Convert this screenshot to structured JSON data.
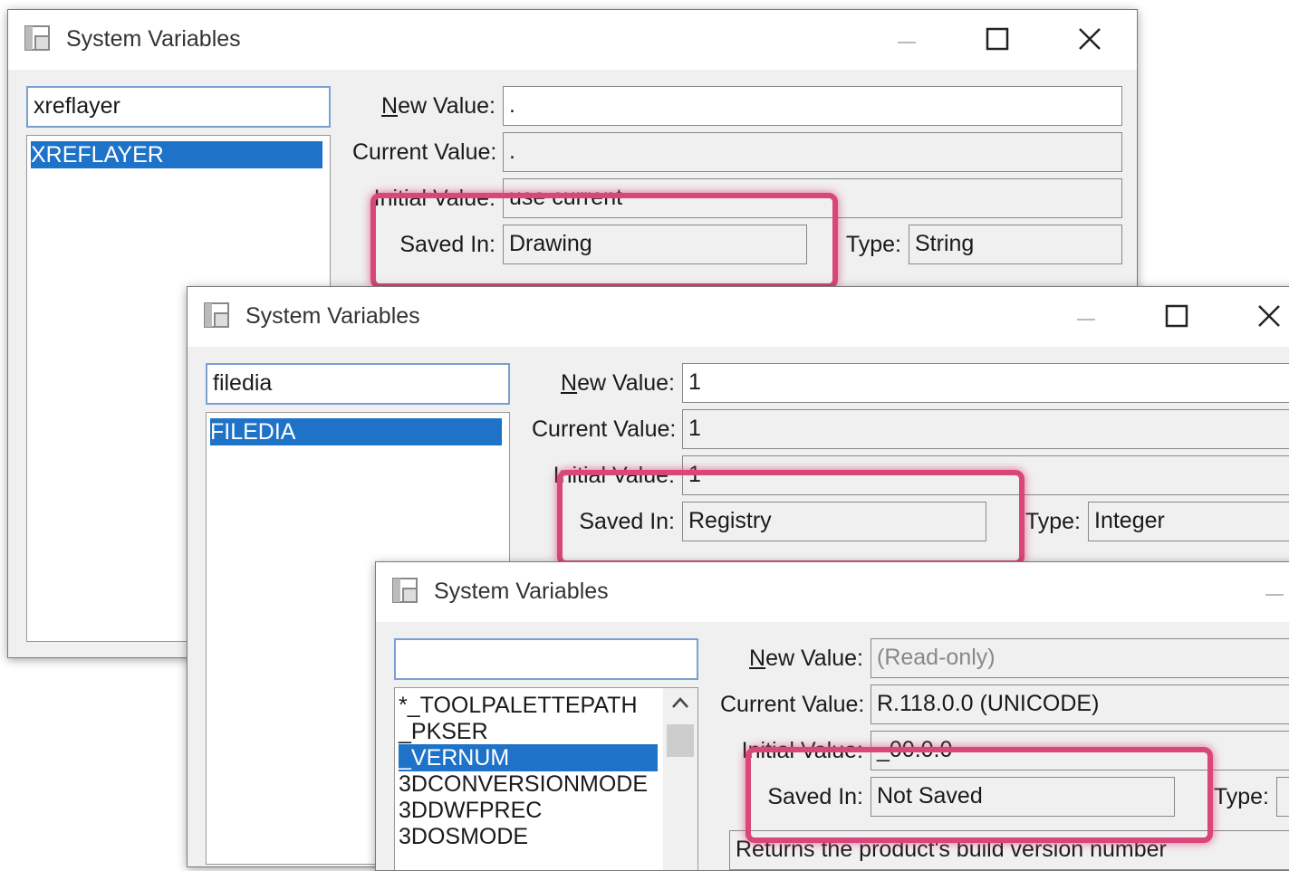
{
  "icons": {
    "app": "system-variables-icon",
    "minimize": "minimize-icon",
    "maximize": "maximize-icon",
    "close": "close-icon",
    "scroll_up": "chevron-up-icon"
  },
  "colors": {
    "selection": "#1e73c8",
    "highlight": "#d8467a"
  },
  "labels": {
    "new_value_prefix": "N",
    "new_value_rest": "ew Value:",
    "current_value": "Current Value:",
    "initial_value": "Initial Value:",
    "saved_in": "Saved In:",
    "type": "Type:"
  },
  "dialog1": {
    "title": "System Variables",
    "search": "xreflayer",
    "list": [
      "XREFLAYER"
    ],
    "new_value": ".",
    "current_value": ".",
    "initial_value": "use current",
    "saved_in": "Drawing",
    "type": "String"
  },
  "dialog2": {
    "title": "System Variables",
    "search": "filedia",
    "list": [
      "FILEDIA"
    ],
    "new_value": "1",
    "current_value": "1",
    "initial_value": "1",
    "saved_in": "Registry",
    "type": "Integer"
  },
  "dialog3": {
    "title": "System Variables",
    "search": "",
    "list": [
      "*_TOOLPALETTEPATH",
      "_PKSER",
      "_VERNUM",
      "3DCONVERSIONMODE",
      "3DDWFPREC",
      "3DOSMODE"
    ],
    "selected_index": 2,
    "new_value": "(Read-only)",
    "current_value": "R.118.0.0 (UNICODE)",
    "initial_value": "_00.0.0",
    "saved_in": "Not Saved",
    "type": "",
    "description": "Returns the product's build version number"
  }
}
